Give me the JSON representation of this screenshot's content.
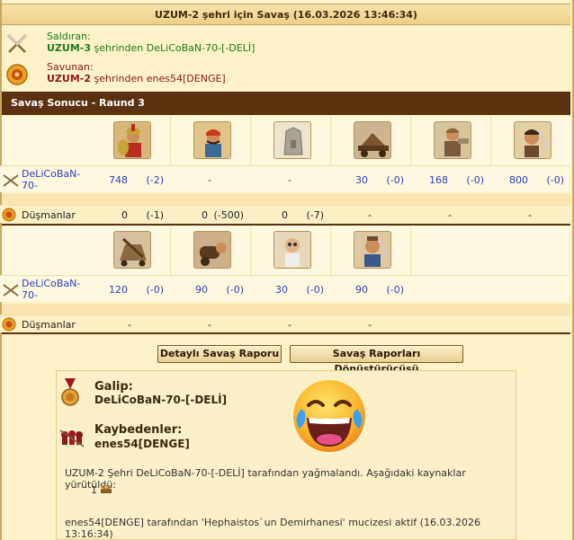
{
  "header": {
    "title": "UZUM-2 şehri için Savaş (16.03.2026 13:46:34)"
  },
  "attacker": {
    "label": "Saldıran:",
    "city": "UZUM-3",
    "middle": " şehrinden ",
    "player": "DeLiCoBaN-70-[-DELİ]"
  },
  "defender": {
    "label": "Savunan:",
    "city": "UZUM-2",
    "middle": " şehrinden ",
    "player": "enes54[DENGE]"
  },
  "section": {
    "title": "Savaş Sonucu - Raund 3"
  },
  "round1": {
    "player_name": "DeLiCoBaN-70-",
    "units": [
      {
        "name": "hoplite",
        "count": "748",
        "loss": "(-2)"
      },
      {
        "name": "slinger",
        "count": "-",
        "loss": ""
      },
      {
        "name": "wall",
        "count": "-",
        "loss": ""
      },
      {
        "name": "ram",
        "count": "30",
        "loss": "(-0)"
      },
      {
        "name": "steam-giant",
        "count": "168",
        "loss": "(-0)"
      },
      {
        "name": "swordsman",
        "count": "800",
        "loss": "(-0)"
      }
    ],
    "enemy_label": "Düşmanlar",
    "enemy": [
      {
        "count": "0",
        "loss": "(-1)"
      },
      {
        "count": "0",
        "loss": "(-500)"
      },
      {
        "count": "0",
        "loss": "(-7)"
      },
      {
        "count": "-",
        "loss": ""
      },
      {
        "count": "-",
        "loss": ""
      },
      {
        "count": "-",
        "loss": ""
      }
    ]
  },
  "round2": {
    "player_name": "DeLiCoBaN-70-",
    "units": [
      {
        "name": "catapult",
        "count": "120",
        "loss": "(-0)"
      },
      {
        "name": "mortar",
        "count": "90",
        "loss": "(-0)"
      },
      {
        "name": "doctor",
        "count": "30",
        "loss": "(-0)"
      },
      {
        "name": "cook",
        "count": "90",
        "loss": "(-0)"
      }
    ],
    "enemy_label": "Düşmanlar",
    "enemy": [
      {
        "count": "-",
        "loss": ""
      },
      {
        "count": "-",
        "loss": ""
      },
      {
        "count": "-",
        "loss": ""
      },
      {
        "count": "-",
        "loss": ""
      }
    ]
  },
  "buttons": {
    "detailed": "Detaylı Savaş Raporu",
    "converter": "Savaş Raporları Dönüştürücüsü"
  },
  "result": {
    "winner_label": "Galip:",
    "winner": "DeLiCoBaN-70-[-DELİ]",
    "loser_label": "Kaybedenler:",
    "loser": "enes54[DENGE]",
    "plunder_text": "UZUM-2 Şehri DeLiCoBaN-70-[-DELİ] tarafından yağmalandı. Aşağıdaki kaynaklar yürütüldü:",
    "plunder_amount": "1",
    "wonder_text": "enes54[DENGE] tarafından 'Hephaistos`un Demirhanesi' mucizesi aktif (16.03.2026 13:16:34)"
  },
  "colors": {
    "header_bar": "#5a3210",
    "link_blue": "#2a3fbf",
    "attacker_green": "#1c7d1c",
    "defender_red": "#8a1a1a"
  }
}
